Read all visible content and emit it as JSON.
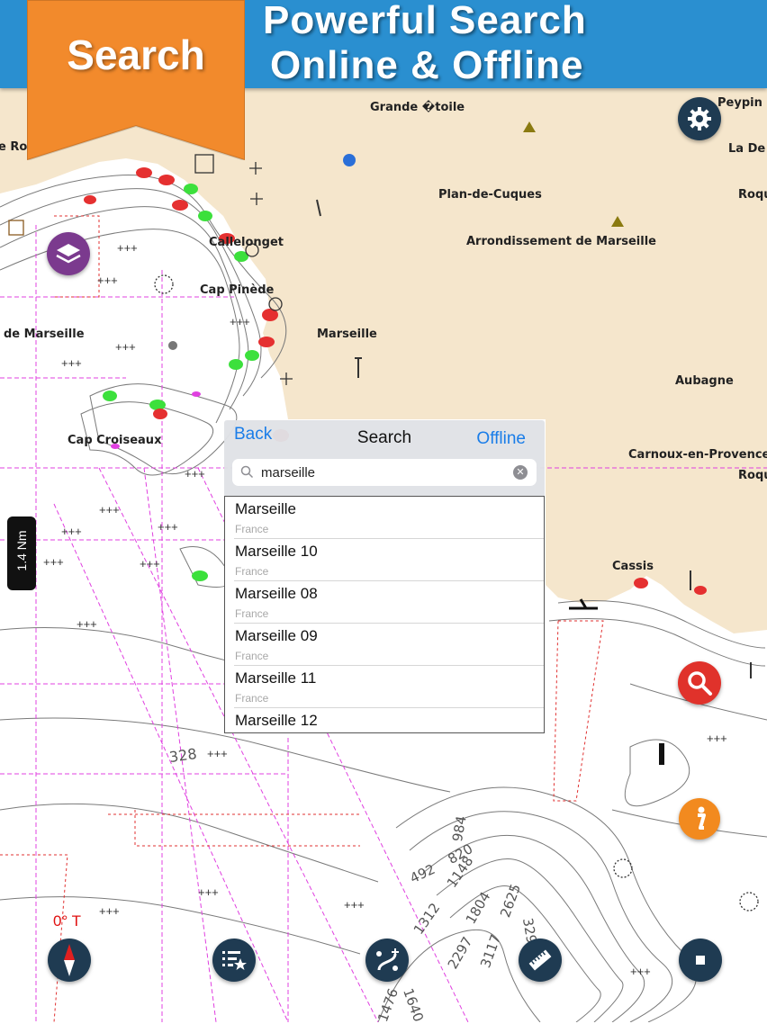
{
  "banner": {
    "line1": "Powerful Search",
    "line2": "Online & Offline",
    "tag": "Search"
  },
  "map_labels": [
    "Grande �toile",
    "Peypin",
    "e Ro",
    "La De",
    "Plan-de-Cuques",
    "Roqu",
    "Arrondissement de Marseille",
    "Callelonget",
    "Cap Pinède",
    "Marseille",
    "de Marseille",
    "Aubagne",
    "Cap Croiseaux",
    "Carnoux-en-Provence",
    "Roqu",
    "Cassis",
    "328",
    "492",
    "820",
    "984",
    "1148",
    "1312",
    "1476",
    "1640",
    "1804",
    "2297",
    "2625",
    "3117",
    "3295"
  ],
  "scale_label": "1.4 Nm",
  "heading_label": "0° T",
  "search": {
    "back_label": "Back",
    "title": "Search",
    "offline_label": "Offline",
    "query": "marseille",
    "results": [
      {
        "name": "Marseille",
        "country": "France"
      },
      {
        "name": "Marseille 10",
        "country": "France"
      },
      {
        "name": "Marseille 08",
        "country": "France"
      },
      {
        "name": "Marseille 09",
        "country": "France"
      },
      {
        "name": "Marseille 11",
        "country": "France"
      },
      {
        "name": "Marseille 12",
        "country": ""
      }
    ]
  },
  "icons": {
    "settings": "gear-icon",
    "layers": "layers-icon",
    "search": "search-icon",
    "info": "info-icon",
    "compass": "compass-icon",
    "favorites": "favorites-list-icon",
    "route": "route-icon",
    "ruler": "ruler-icon",
    "stop": "stop-icon"
  },
  "colors": {
    "banner": "#2a8fd0",
    "ribbon": "#f28a2c",
    "land": "#f5e6cc",
    "sea": "#ffffff",
    "button_dark": "#1f3b52",
    "layers_button": "#7b3a8e",
    "search_button": "#e0322b",
    "info_button": "#f28a1f"
  }
}
